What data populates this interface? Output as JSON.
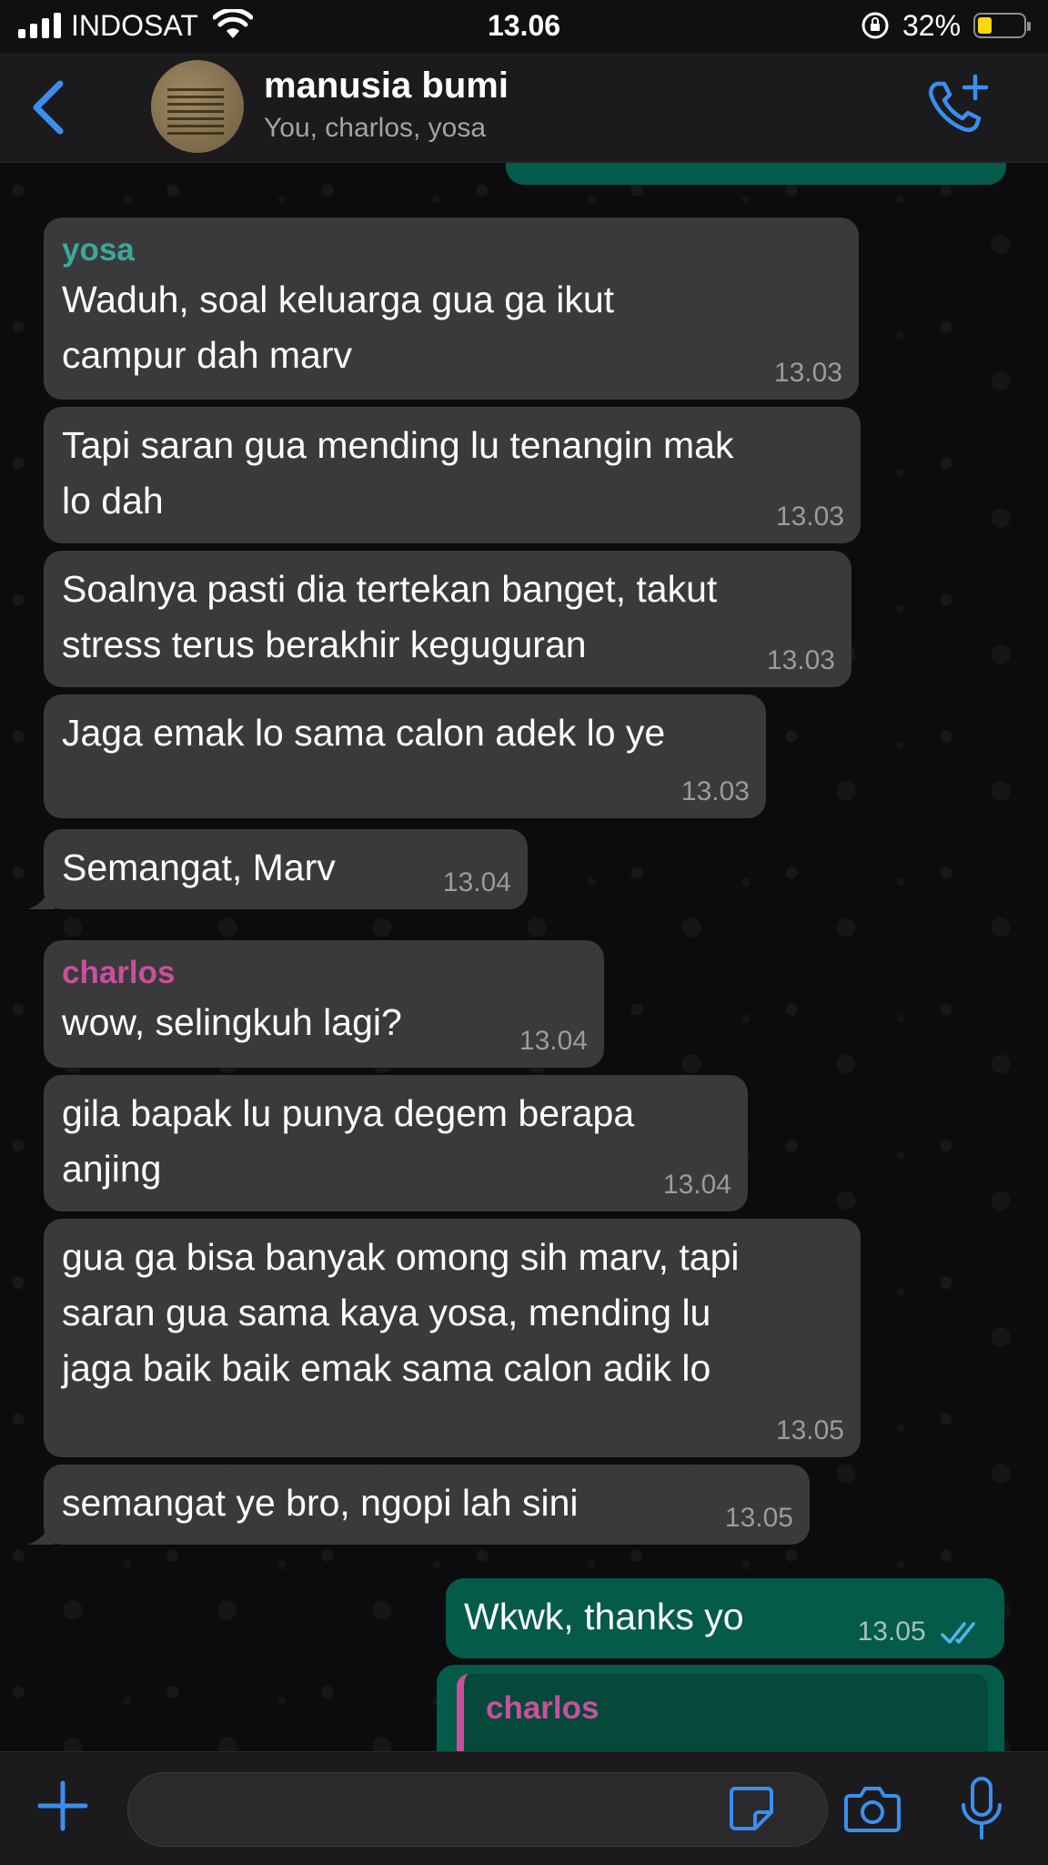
{
  "status_bar": {
    "carrier": "INDOSAT",
    "time": "13.06",
    "battery": "32%"
  },
  "header": {
    "title": "manusia bumi",
    "subtitle": "You, charlos, yosa"
  },
  "colors": {
    "accent": "#3b8ef0",
    "incoming_bubble": "#3a3a3d",
    "outgoing_bubble": "#045b49",
    "yosa": "#3ba89a",
    "charlos": "#c9509b"
  },
  "messages": [
    {
      "sender": "yosa",
      "text": "Waduh, soal keluarga gua ga ikut\ncampur dah marv",
      "time": "13.03"
    },
    {
      "text": "Tapi saran gua mending lu tenangin mak\nlo dah",
      "time": "13.03"
    },
    {
      "text": "Soalnya pasti dia tertekan banget, takut\nstress terus berakhir keguguran",
      "time": "13.03"
    },
    {
      "text": "Jaga emak lo sama calon adek lo ye",
      "time": "13.03"
    },
    {
      "text": "Semangat, Marv",
      "time": "13.04"
    },
    {
      "sender": "charlos",
      "text": "wow, selingkuh lagi?",
      "time": "13.04"
    },
    {
      "text": "gila bapak lu punya degem berapa\nanjing",
      "time": "13.04"
    },
    {
      "text": "gua ga bisa banyak omong sih marv, tapi\nsaran gua sama kaya yosa, mending lu\njaga baik baik emak sama calon adik lo",
      "time": "13.05"
    },
    {
      "text": "semangat ye bro, ngopi lah sini",
      "time": "13.05"
    },
    {
      "text": "Wkwk, thanks yo",
      "time": "13.05"
    },
    {
      "reply_sender": "charlos"
    }
  ]
}
